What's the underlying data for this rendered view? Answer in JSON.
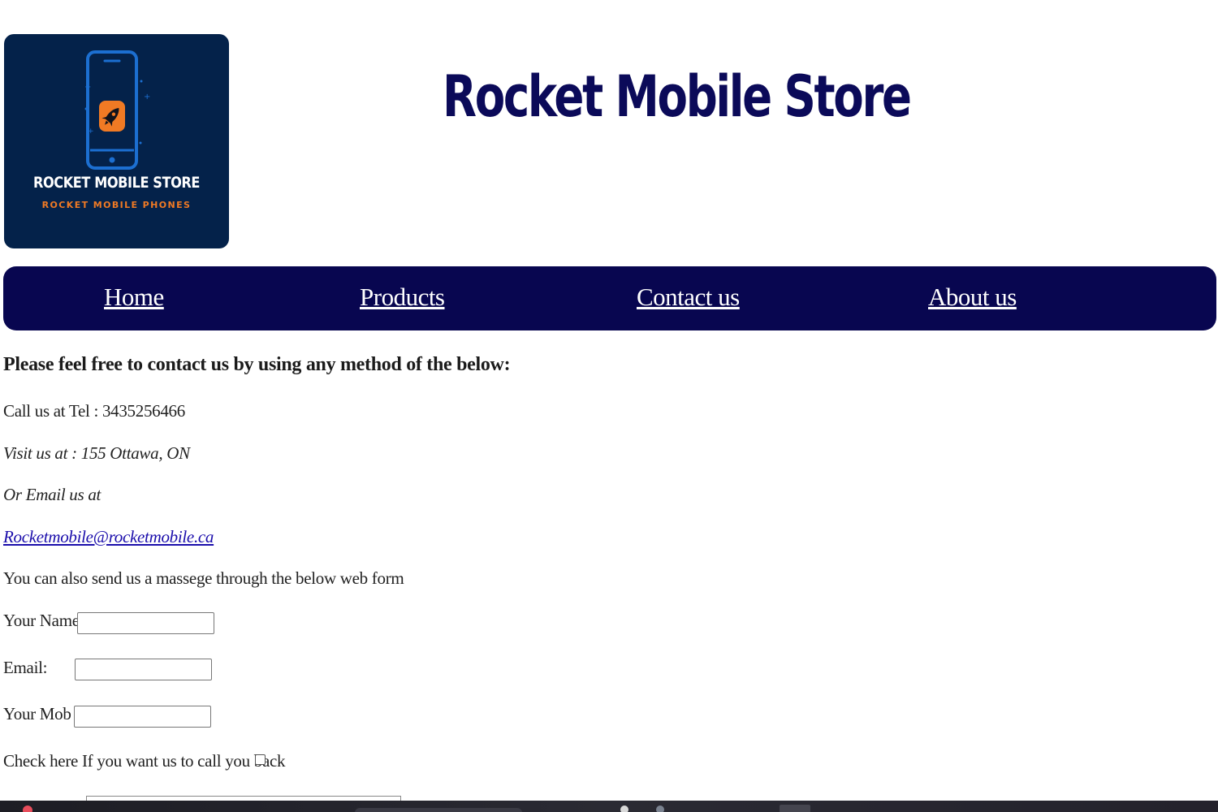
{
  "header": {
    "logo": {
      "title": "ROCKET MOBILE STORE",
      "subtitle": "ROCKET MOBILE PHONES",
      "background_color": "#04224a",
      "phone_color": "#1c6fd1",
      "accent_color": "#f07a24"
    },
    "site_title": "Rocket Mobile Store",
    "title_color": "#0b0a59"
  },
  "nav": {
    "background_color": "#080650",
    "items": [
      {
        "label": "Home"
      },
      {
        "label": "Products"
      },
      {
        "label": "Contact us"
      },
      {
        "label": "About us"
      }
    ]
  },
  "contact": {
    "heading": "Please feel free to contact us by using any method of the below:",
    "phone_line": "Call us at Tel : 3435256466",
    "visit_line": "Visit us at : 155 Ottawa, ON",
    "email_intro": "Or Email us at",
    "email": "Rocketmobile@rocketmobile.ca",
    "webform_intro": "You can also send us a massege through the below web form"
  },
  "form": {
    "name_label": "Your Name:",
    "name_value": "",
    "email_label": "Email:",
    "email_value": "",
    "mob_label": "Your Mob :",
    "mob_value": "",
    "callback_label": "Check here If you want us to call you back",
    "callback_checked": false
  },
  "taskbar": {
    "icons": [
      "app-icon",
      "pin-icon",
      "user-icon"
    ]
  }
}
